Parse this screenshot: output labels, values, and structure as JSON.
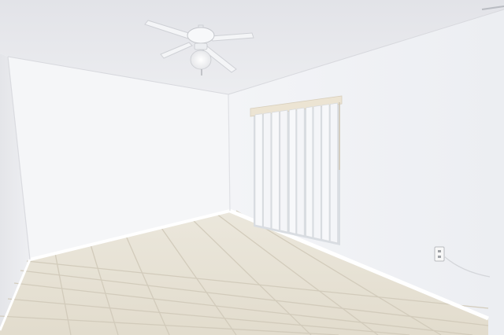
{
  "scene": {
    "description_type": "photo-interior-empty-room",
    "colors": {
      "ceiling": "#e7e8ec",
      "back_wall": "#f5f6f8",
      "right_wall": "#f2f3f6",
      "left_wall": "#eaebee",
      "floor_tile": "#e7e2d6",
      "grout": "#d2cbbb",
      "baseboard": "#ffffff",
      "blind": "#f7f8fa",
      "window_frame": "#e9e1d2"
    },
    "elements": [
      "ceiling-fan",
      "vertical-blinds",
      "window",
      "tile-floor",
      "power-outlet",
      "baseboard"
    ]
  }
}
